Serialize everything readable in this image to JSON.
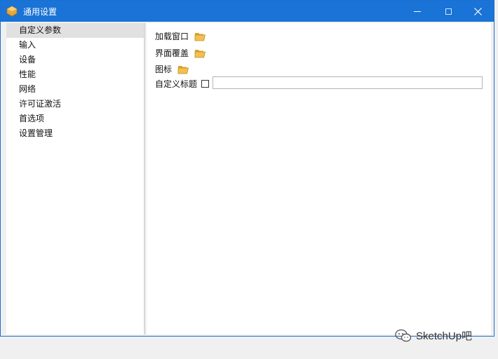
{
  "window": {
    "title": "通用设置"
  },
  "sidebar": {
    "items": [
      {
        "label": "自定义参数",
        "active": true
      },
      {
        "label": "输入"
      },
      {
        "label": "设备"
      },
      {
        "label": "性能"
      },
      {
        "label": "网络"
      },
      {
        "label": "许可证激活"
      },
      {
        "label": "首选项"
      },
      {
        "label": "设置管理"
      }
    ]
  },
  "main": {
    "load_window_label": "加载窗口",
    "ui_overlay_label": "界面覆盖",
    "icon_label": "图标",
    "custom_title_label": "自定义标题",
    "custom_title_checked": false,
    "custom_title_value": ""
  },
  "watermark": {
    "text": "SketchUp吧"
  },
  "colors": {
    "titlebar": "#1a73d6",
    "folder": "#f2c14e"
  },
  "icons": [
    "app-icon",
    "folder-open-icon",
    "wechat-icon"
  ]
}
